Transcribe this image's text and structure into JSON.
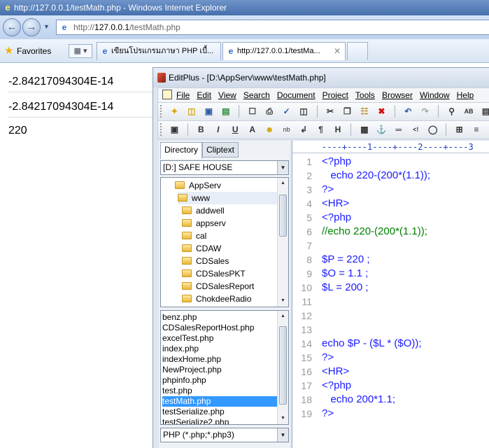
{
  "ie": {
    "title": "http://127.0.0.1/testMath.php - Windows Internet Explorer",
    "address_prefix": "http://",
    "address_host": "127.0.0.1",
    "address_path": "/testMath.php",
    "favorites_label": "Favorites",
    "tabs": [
      {
        "label": "เขียนโปรแกรมภาษา PHP เบื้..."
      },
      {
        "label": "http://127.0.0.1/testMa..."
      }
    ]
  },
  "page": {
    "lines": [
      "-2.84217094304E-14",
      "-2.84217094304E-14",
      "220"
    ]
  },
  "editplus": {
    "title": "EditPlus - [D:\\AppServ\\www\\testMath.php]",
    "menu": [
      "File",
      "Edit",
      "View",
      "Search",
      "Document",
      "Project",
      "Tools",
      "Browser",
      "Window",
      "Help"
    ],
    "panel_tabs": [
      "Directory",
      "Cliptext"
    ],
    "drive": "[D:] SAFE HOUSE",
    "tree": [
      {
        "label": "AppServ",
        "level": 0
      },
      {
        "label": "www",
        "level": 1
      },
      {
        "label": "addwell",
        "level": 2
      },
      {
        "label": "appserv",
        "level": 2
      },
      {
        "label": "cal",
        "level": 2
      },
      {
        "label": "CDAW",
        "level": 2
      },
      {
        "label": "CDSales",
        "level": 2
      },
      {
        "label": "CDSalesPKT",
        "level": 2
      },
      {
        "label": "CDSalesReport",
        "level": 2
      },
      {
        "label": "ChokdeeRadio",
        "level": 2
      }
    ],
    "files": [
      "benz.php",
      "CDSalesReportHost.php",
      "excelTest.php",
      "index.php",
      "indexHome.php",
      "NewProject.php",
      "phpinfo.php",
      "test.php",
      "testMath.php",
      "testSerialize.php",
      "testSerialize2.php"
    ],
    "selected_file": "testMath.php",
    "filter": "PHP (*.php;*.php3)",
    "ruler": "----+----1----+----2----+----3",
    "code": [
      {
        "n": "1",
        "text": "<?php",
        "color": "#1a1aff"
      },
      {
        "n": "2",
        "text": "   echo 220-(200*(1.1));",
        "color": "#1a1aff"
      },
      {
        "n": "3",
        "text": "?>",
        "color": "#1a1aff"
      },
      {
        "n": "4",
        "text": "<HR>",
        "color": "#1a1aff"
      },
      {
        "n": "5",
        "text": "<?php",
        "color": "#1a1aff"
      },
      {
        "n": "6",
        "text": "//echo 220-(200*(1.1));",
        "color": "#008000"
      },
      {
        "n": "7",
        "text": "",
        "color": "#1a1aff"
      },
      {
        "n": "8",
        "text": "$P = 220 ;",
        "color": "#1a1aff"
      },
      {
        "n": "9",
        "text": "$O = 1.1 ;",
        "color": "#1a1aff"
      },
      {
        "n": "10",
        "text": "$L = 200 ;",
        "color": "#1a1aff"
      },
      {
        "n": "11",
        "text": "",
        "color": "#1a1aff"
      },
      {
        "n": "12",
        "text": "",
        "color": "#1a1aff"
      },
      {
        "n": "13",
        "text": "",
        "color": "#1a1aff"
      },
      {
        "n": "14",
        "text": "echo $P - ($L * ($O));",
        "color": "#1a1aff"
      },
      {
        "n": "15",
        "text": "?>",
        "color": "#1a1aff"
      },
      {
        "n": "16",
        "text": "<HR>",
        "color": "#1a1aff"
      },
      {
        "n": "17",
        "text": "<?php",
        "color": "#1a1aff"
      },
      {
        "n": "18",
        "text": "   echo 200*1.1;",
        "color": "#1a1aff"
      },
      {
        "n": "19",
        "text": "?>",
        "color": "#1a1aff"
      }
    ]
  }
}
